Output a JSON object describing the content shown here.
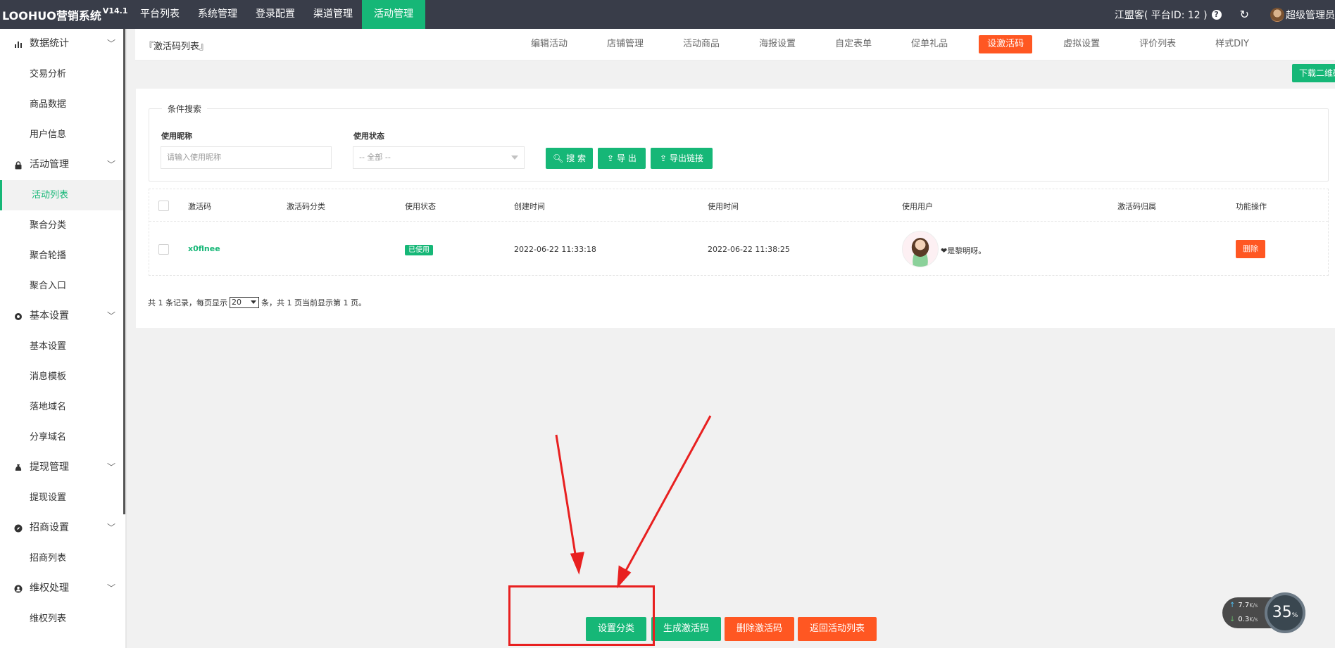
{
  "header": {
    "brand": "LOOHUO营销系统",
    "version": "V14.1",
    "nav": [
      "平台列表",
      "系统管理",
      "登录配置",
      "渠道管理",
      "活动管理"
    ],
    "active_nav": "活动管理",
    "platform": "江盟客( 平台ID: 12 )",
    "help_icon": "?",
    "refresh_icon": "↻",
    "admin": "超级管理员"
  },
  "sidebar": {
    "groups": [
      {
        "label": "数据统计",
        "icon": "bar-chart-icon",
        "items": [
          "交易分析",
          "商品数据",
          "用户信息"
        ]
      },
      {
        "label": "活动管理",
        "icon": "lock-icon",
        "items": [
          "活动列表",
          "聚合分类",
          "聚合轮播",
          "聚合入口"
        ]
      },
      {
        "label": "基本设置",
        "icon": "settings-icon",
        "items": [
          "基本设置",
          "消息模板",
          "落地域名",
          "分享域名"
        ]
      },
      {
        "label": "提现管理",
        "icon": "moneybag-icon",
        "items": [
          "提现设置"
        ]
      },
      {
        "label": "招商设置",
        "icon": "compass-icon",
        "items": [
          "招商列表"
        ]
      },
      {
        "label": "维权处理",
        "icon": "user-icon",
        "items": [
          "维权列表"
        ]
      }
    ],
    "active_item": "活动列表"
  },
  "tabbar": {
    "breadcrumb": "『激活码列表』",
    "tabs": [
      "编辑活动",
      "店铺管理",
      "活动商品",
      "海报设置",
      "自定表单",
      "促单礼品",
      "设激活码",
      "虚拟设置",
      "评价列表",
      "样式DIY"
    ],
    "active_tab": "设激活码"
  },
  "download_button": "下载二维码",
  "search": {
    "legend": "条件搜索",
    "nickname_label": "使用昵称",
    "nickname_placeholder": "请输入使用昵称",
    "status_label": "使用状态",
    "status_value": "-- 全部 --",
    "search_btn": "搜 索",
    "export_btn": "导 出",
    "export_link_btn": "导出链接"
  },
  "table": {
    "columns": [
      "激活码",
      "激活码分类",
      "使用状态",
      "创建时间",
      "使用时间",
      "使用用户",
      "激活码归属",
      "功能操作"
    ],
    "rows": [
      {
        "code": "x0flnee",
        "category": "",
        "status": "已使用",
        "created": "2022-06-22 11:33:18",
        "used": "2022-06-22 11:38:25",
        "user": "❤是黎明呀。",
        "owner": "",
        "action": "删除"
      }
    ]
  },
  "pager": {
    "prefix": "共 1 条记录，每页显示",
    "page_size": "20",
    "suffix": "条，共 1 页当前显示第 1 页。"
  },
  "actions": {
    "set_category": "设置分类",
    "generate": "生成激活码",
    "delete_codes": "删除激活码",
    "back": "返回活动列表"
  },
  "network": {
    "up": "7.7",
    "down": "0.3",
    "unit": "K/s",
    "cpu": "35",
    "cpu_unit": "%"
  },
  "colors": {
    "topbar": "#393d49",
    "green": "#16b777",
    "orange": "#ff5722",
    "annotation": "#e82020"
  }
}
